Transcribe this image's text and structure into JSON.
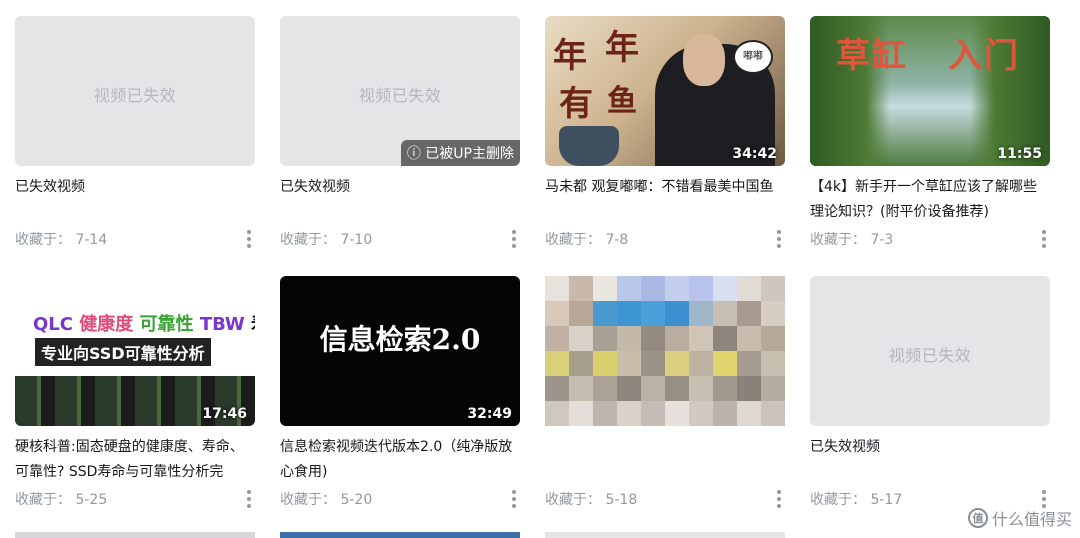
{
  "videos": [
    {
      "title": "已失效视频",
      "fav_date": "收藏于： 7-14",
      "invalid_text": "视频已失效",
      "duration": "",
      "badge": ""
    },
    {
      "title": "已失效视频",
      "fav_date": "收藏于： 7-10",
      "invalid_text": "视频已失效",
      "duration": "",
      "badge": "已被UP主删除"
    },
    {
      "title": "马未都 观复嘟嘟：不错看最美中国鱼",
      "fav_date": "收藏于： 7-8",
      "invalid_text": "",
      "duration": "34:42",
      "badge": "",
      "thumb_text": [
        "年",
        "年",
        "有",
        "鱼",
        "嘟嘟"
      ]
    },
    {
      "title": "【4k】新手开一个草缸应该了解哪些理论知识？(附平价设备推荐)",
      "fav_date": "收藏于： 7-3",
      "invalid_text": "",
      "duration": "11:55",
      "badge": "",
      "thumb_text": [
        "草缸",
        "入门"
      ]
    },
    {
      "title": "硬核科普:固态硬盘的健康度、寿命、可靠性? SSD寿命与可靠性分析完",
      "fav_date": "收藏于： 5-25",
      "invalid_text": "",
      "duration": "17:46",
      "badge": "",
      "thumb_text": [
        "QLC",
        "健康度",
        "可靠性",
        "TBW",
        "寿",
        "专业向SSD可靠性分析"
      ]
    },
    {
      "title": "信息检索视频迭代版本2.0（纯净版放心食用)",
      "fav_date": "收藏于： 5-20",
      "invalid_text": "",
      "duration": "32:49",
      "badge": "",
      "thumb_text": [
        "信息检索2.0"
      ]
    },
    {
      "title": "",
      "fav_date": "收藏于： 5-18",
      "invalid_text": "",
      "duration": "",
      "badge": ""
    },
    {
      "title": "已失效视频",
      "fav_date": "收藏于： 5-17",
      "invalid_text": "视频已失效",
      "duration": "",
      "badge": ""
    }
  ],
  "watermark": {
    "text": "什么值得买",
    "icon": "值"
  },
  "colors": {
    "placeholder": "#e3e5e7",
    "date": "#9499a0",
    "text": "#18191c"
  }
}
